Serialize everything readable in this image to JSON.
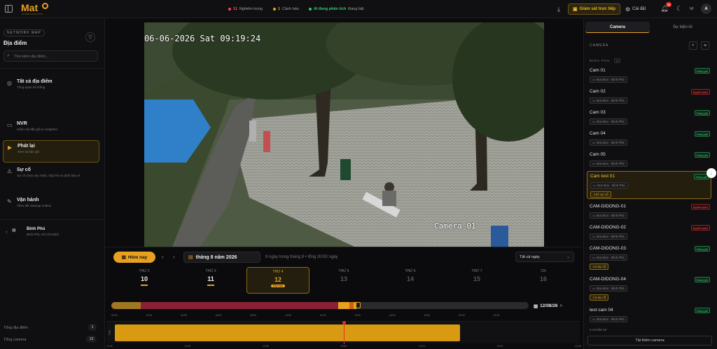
{
  "app": {
    "logo": "Mat",
    "logo_sub": "AI VIDEO ANALYTICS"
  },
  "topbar": {
    "alerts_count": "11",
    "alerts_label": "Nghiêm trọng",
    "warnings_count": "1",
    "warnings_label": "Cảnh báo",
    "ai_label": "AI đang phân tích",
    "ai_state": "Đang bật",
    "live_button": "Giám sát trực tiếp",
    "settings_button": "Cài đặt",
    "notif_count": "38",
    "lang": "VI",
    "avatar": "A"
  },
  "sidebar": {
    "section": "NETWORK MAP",
    "title": "Địa điểm",
    "search_placeholder": "Tìm kiếm địa điểm...",
    "items": [
      {
        "title": "Tất cả địa điểm",
        "sub": "Tổng quan hệ thống",
        "icon": "globe-icon"
      },
      {
        "title": "NVR",
        "sub": "Giám sát đầu ghi & snapshot",
        "icon": "nvr-icon"
      },
      {
        "title": "Phát lại",
        "sub": "Xem lại bản ghi",
        "icon": "playback-icon"
      },
      {
        "title": "Sự cố",
        "sub": "Sự cố chưa xác nhận, hộp thư & cảnh báo AI",
        "icon": "warning-icon"
      },
      {
        "title": "Vận hành",
        "sub": "Theo dõi cleanup outbox",
        "icon": "wrench-icon"
      }
    ],
    "location": {
      "name": "Bình Phú",
      "sub": "Bình Phú, Hồ Chí Minh"
    },
    "total_locations_label": "Tổng địa điểm",
    "total_locations": "1",
    "total_cameras_label": "Tổng camera",
    "total_cameras": "13"
  },
  "video": {
    "timestamp": "06-06-2026 Sat 09:19:24",
    "camera_label": "Camera 01"
  },
  "playback": {
    "today_button": "Hôm nay",
    "month": "tháng 8 năm 2026",
    "summary": "9 ngày trong tháng 8 • tổng 20/30 ngày",
    "filter": "Tất cả ngày",
    "days": [
      {
        "dow": "THỨ 2",
        "date": "10",
        "mark": true,
        "active": false,
        "dim": false
      },
      {
        "dow": "THỨ 3",
        "date": "11",
        "mark": true,
        "active": false,
        "dim": false
      },
      {
        "dow": "THỨ 4",
        "date": "12",
        "mark": false,
        "active": true,
        "dim": false,
        "badge": "Hôm nay"
      },
      {
        "dow": "THỨ 5",
        "date": "13",
        "mark": false,
        "active": false,
        "dim": true
      },
      {
        "dow": "THỨ 6",
        "date": "14",
        "mark": false,
        "active": false,
        "dim": true
      },
      {
        "dow": "THỨ 7",
        "date": "15",
        "mark": false,
        "active": false,
        "dim": true
      },
      {
        "dow": "CN",
        "date": "16",
        "mark": false,
        "active": false,
        "dim": true
      }
    ],
    "selected_date": "12/08/26",
    "overview_ticks": [
      "00:00",
      "02:00",
      "04:00",
      "06:00",
      "08:00",
      "10:00",
      "12:00",
      "14:00",
      "16:00",
      "18:00",
      "20:00",
      "22:00"
    ],
    "track_label": "REC",
    "bottom_ticks": [
      "12:30",
      "12:40",
      "12:50",
      "13:00",
      "13:10",
      "13:20",
      "13:30"
    ]
  },
  "right": {
    "tab_camera": "Camera",
    "tab_events": "Sự kiện AI",
    "section": "CAMERA",
    "group": "BINH PHU",
    "group_count": "13",
    "status_on": "Đang ghi",
    "status_off": "Ngoại tuyến",
    "cameras": [
      {
        "name": "Cam 01",
        "tag": "Box Box · Bình Phú",
        "status": "on"
      },
      {
        "name": "Cam 02",
        "tag": "Box Box · Bình Phú",
        "status": "off"
      },
      {
        "name": "Cam 03",
        "tag": "Box Box · Bình Phú",
        "status": "on"
      },
      {
        "name": "Cam 04",
        "tag": "Box Box · Bình Phú",
        "status": "on"
      },
      {
        "name": "Cam 05",
        "tag": "Box Box · Bình Phú",
        "status": "on"
      },
      {
        "name": "Cam test 01",
        "tag": "Box Box · Bình Phú",
        "status": "on",
        "warn": "67 sự cố",
        "selected": true
      },
      {
        "name": "CAM-DIDONG-01",
        "tag": "Box Box · Bình Phú",
        "status": "off"
      },
      {
        "name": "CAM-DIDONG-02",
        "tag": "Box Box · Bình Phú",
        "status": "off"
      },
      {
        "name": "CAM-DIDONG-03",
        "tag": "Box Box · Bình Phú",
        "status": "on",
        "warn": "2 sự cố"
      },
      {
        "name": "CAM-DIDONG-04",
        "tag": "Box Box · Bình Phú",
        "status": "on",
        "warn": "2 sự cố"
      },
      {
        "name": "test cam 04",
        "tag": "Box Box · Bình Phú",
        "status": "on"
      }
    ],
    "footer_count": "1-12 trên 13",
    "add_button": "Tải thêm camera"
  },
  "colors": {
    "accent": "#e8a020",
    "danger": "#ff4040",
    "ok": "#2ecc71"
  }
}
